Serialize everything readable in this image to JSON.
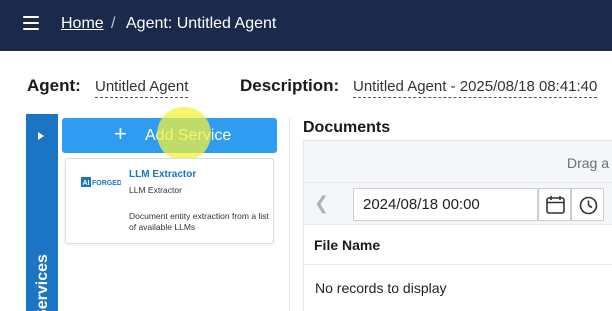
{
  "nav": {
    "menu_icon": "hamburger-icon",
    "breadcrumb_home": "Home",
    "breadcrumb_separator": "/",
    "breadcrumb_current": "Agent: Untitled Agent"
  },
  "agent": {
    "label": "Agent:",
    "name": "Untitled Agent",
    "description_label": "Description:",
    "description": "Untitled Agent - 2025/08/18 08:41:40"
  },
  "services": {
    "tab_label": "Services",
    "add_button_label": "Add Service",
    "cards": [
      {
        "logo_text": "AI FORGED",
        "title": "LLM Extractor",
        "subtitle": "LLM Extractor",
        "description": "Document entity extraction from a list of available LLMs"
      }
    ]
  },
  "documents": {
    "title": "Documents",
    "drag_text": "Drag a",
    "date_value": "2024/08/18 00:00",
    "column_file_name": "File Name",
    "empty_message": "No records to display"
  },
  "colors": {
    "topbar": "#1b2a4a",
    "services_tab": "#1b74c4",
    "add_button": "#2e9cf0",
    "cursor_highlight": "#f0f03c"
  }
}
